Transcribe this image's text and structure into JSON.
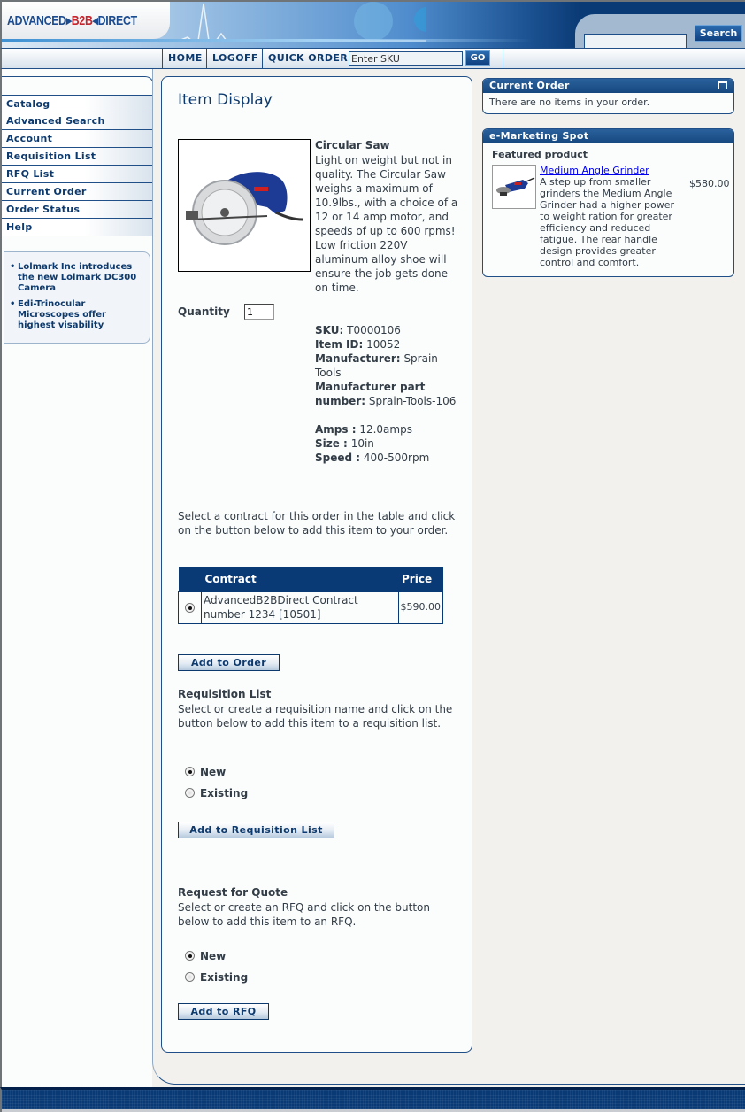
{
  "header": {
    "logo_part1": "ADVANCED",
    "logo_part2": "B2B",
    "logo_part3": "DIRECT",
    "search_value": "",
    "search_button": "Search"
  },
  "nav": {
    "home": "HOME",
    "logoff": "LOGOFF",
    "quick_order": "QUICK ORDER",
    "sku_placeholder": "Enter SKU",
    "go": "GO"
  },
  "sidebar": {
    "items": [
      {
        "label": "Catalog"
      },
      {
        "label": "Advanced Search"
      },
      {
        "label": "Account"
      },
      {
        "label": "Requisition List"
      },
      {
        "label": "RFQ List"
      },
      {
        "label": "Current Order"
      },
      {
        "label": "Order Status"
      },
      {
        "label": "Help"
      }
    ],
    "news": [
      "Lolmark Inc introduces the new Lolmark DC300 Camera",
      "Edi-Trinocular Microscopes offer highest visability"
    ]
  },
  "main": {
    "title": "Item Display",
    "product": {
      "name": "Circular Saw",
      "image_icon": "circular-saw-image",
      "description": "Light on weight but not in quality. The Circular Saw weighs a maximum of 10.9lbs., with a choice of a 12 or 14 amp motor, and speeds of up to 600 rpms! Low friction 220V aluminum alloy shoe will ensure the job gets done on time.",
      "quantity_label": "Quantity",
      "quantity_value": "1",
      "sku_label": "SKU:",
      "sku": "T0000106",
      "item_id_label": "Item ID:",
      "item_id": "10052",
      "manufacturer_label": "Manufacturer:",
      "manufacturer": "Sprain Tools",
      "mfr_part_label": "Manufacturer part number:",
      "mfr_part": "Sprain-Tools-106",
      "amps_label": "Amps :",
      "amps": "12.0amps",
      "size_label": "Size :",
      "size": "10in",
      "speed_label": "Speed :",
      "speed": "400-500rpm"
    },
    "contract_instructions": "Select a contract for this order in the table and click on the button below to add this item to your order.",
    "contract_table": {
      "headers": [
        "",
        "Contract",
        "Price"
      ],
      "rows": [
        {
          "selected": true,
          "contract": "AdvancedB2BDirect Contract number 1234 [10501]",
          "price": "$590.00"
        }
      ]
    },
    "add_to_order": "Add to Order",
    "requisition": {
      "title": "Requisition List",
      "description": "Select or create a requisition name and click on the button below to add this item to a requisition list.",
      "options": [
        {
          "label": "New",
          "selected": true
        },
        {
          "label": "Existing",
          "selected": false
        }
      ],
      "button": "Add to Requisition List"
    },
    "rfq": {
      "title": "Request for Quote",
      "description": "Select or create an RFQ and click on the button below to add this item to an RFQ.",
      "options": [
        {
          "label": "New",
          "selected": true
        },
        {
          "label": "Existing",
          "selected": false
        }
      ],
      "button": "Add to RFQ"
    }
  },
  "right": {
    "current_order": {
      "title": "Current Order",
      "message": "There are no items in your order."
    },
    "marketing": {
      "title": "e-Marketing Spot",
      "featured_label": "Featured product",
      "product_name": "Medium Angle Grinder",
      "product_desc": "A step up from smaller grinders the Medium Angle Grinder had a higher power to weight ration for greater efficiency and reduced fatigue. The rear handle design provides greater control and comfort.",
      "price": "$580.00"
    }
  }
}
